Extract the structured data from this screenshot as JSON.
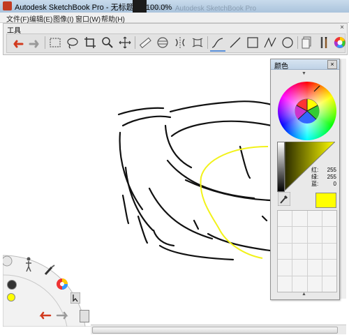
{
  "window": {
    "title": "Autodesk SketchBook Pro - 无标题 @ 100.0%",
    "ghost_title": "无标题 - Autodesk SketchBook Pro"
  },
  "menu": [
    {
      "id": "file",
      "label": "文件(F)"
    },
    {
      "id": "edit",
      "label": "编辑(E)"
    },
    {
      "id": "image",
      "label": "图像(I)"
    },
    {
      "id": "window",
      "label": "窗口(W)"
    },
    {
      "id": "help",
      "label": "帮助(H)"
    }
  ],
  "toolbar": {
    "title": "工具",
    "close": "×",
    "tools": [
      {
        "name": "undo-icon",
        "color": "#d23a1e"
      },
      {
        "name": "redo-icon",
        "color": "#9a9a9a"
      },
      {
        "name": "rect-select-icon"
      },
      {
        "name": "lasso-icon"
      },
      {
        "name": "crop-icon"
      },
      {
        "name": "zoom-icon"
      },
      {
        "name": "move-icon"
      },
      {
        "name": "ruler-icon"
      },
      {
        "name": "ellipse-guide-icon"
      },
      {
        "name": "symmetry-icon"
      },
      {
        "name": "distort-icon"
      },
      {
        "name": "freehand-line-icon"
      },
      {
        "name": "line-icon"
      },
      {
        "name": "rectangle-icon"
      },
      {
        "name": "polyline-icon"
      },
      {
        "name": "circle-icon"
      },
      {
        "name": "layers-icon"
      },
      {
        "name": "brushes-icon"
      },
      {
        "name": "color-wheel-icon"
      }
    ]
  },
  "color_panel": {
    "title": "颜色",
    "close": "×",
    "rgb": [
      {
        "label": "红:",
        "value": "255"
      },
      {
        "label": "绿:",
        "value": "255"
      },
      {
        "label": "蓝:",
        "value": "0"
      }
    ],
    "current_color": "#ffff00"
  },
  "lagoon": {
    "undo_color": "#d23a1e",
    "redo_color": "#9a9a9a",
    "brush_color": "#ffff00"
  }
}
